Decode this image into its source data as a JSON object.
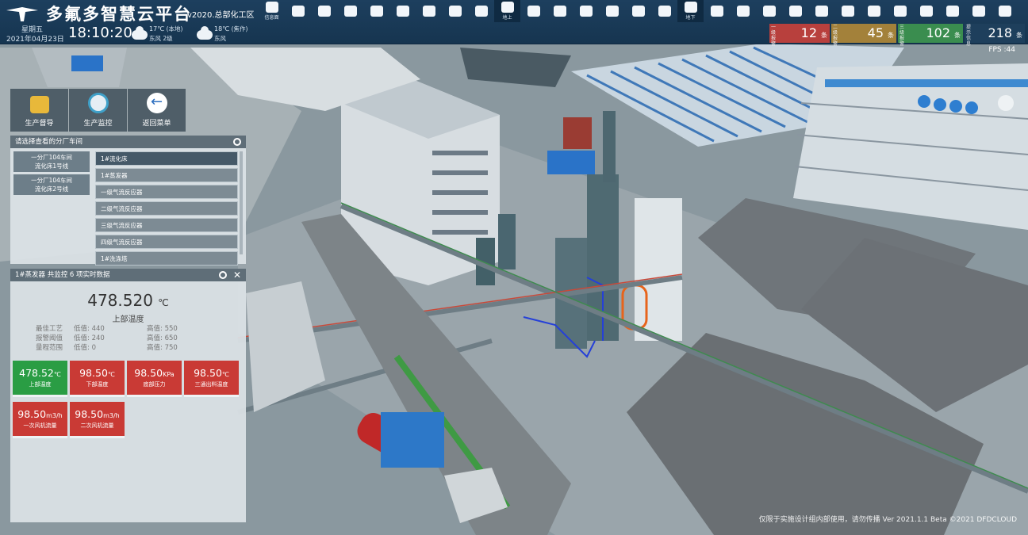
{
  "header": {
    "title": "多氟多智慧云平台",
    "version": "v2020.总部化工区",
    "weekday": "星期五",
    "date": "2021年04月23日",
    "time": "18:10:20",
    "weather": [
      {
        "temp": "17℃",
        "note": "(本地)",
        "wind": "东风 2级"
      },
      {
        "temp": "18℃",
        "note": "(焦作)",
        "wind": "东风"
      }
    ]
  },
  "toolbar": [
    {
      "name": "message-tool",
      "label": "信息面"
    },
    {
      "name": "tool-2",
      "label": ""
    },
    {
      "name": "tool-3",
      "label": ""
    },
    {
      "name": "tool-4",
      "label": ""
    },
    {
      "name": "tool-5",
      "label": ""
    },
    {
      "name": "tool-6",
      "label": ""
    },
    {
      "name": "tool-7",
      "label": ""
    },
    {
      "name": "tool-8",
      "label": ""
    },
    {
      "name": "tool-9",
      "label": ""
    },
    {
      "name": "ground-up-tool",
      "label": "地上"
    },
    {
      "name": "layers-tool",
      "label": ""
    },
    {
      "name": "tool-12",
      "label": ""
    },
    {
      "name": "tool-13",
      "label": ""
    },
    {
      "name": "tool-14",
      "label": ""
    },
    {
      "name": "tool-15",
      "label": ""
    },
    {
      "name": "map-tool",
      "label": ""
    },
    {
      "name": "underground-tool",
      "label": "地下"
    },
    {
      "name": "tool-18",
      "label": ""
    },
    {
      "name": "tool-19",
      "label": ""
    },
    {
      "name": "tool-20",
      "label": ""
    },
    {
      "name": "tool-21",
      "label": ""
    },
    {
      "name": "tool-22",
      "label": ""
    },
    {
      "name": "power-tool",
      "label": ""
    },
    {
      "name": "tool-24",
      "label": ""
    },
    {
      "name": "tool-25",
      "label": ""
    },
    {
      "name": "chat-tool",
      "label": ""
    },
    {
      "name": "tool-27",
      "label": ""
    },
    {
      "name": "settings-tool",
      "label": ""
    },
    {
      "name": "power-off-tool",
      "label": ""
    }
  ],
  "stats": [
    {
      "name": "一级报警",
      "value": "12",
      "unit": "条",
      "color": "#b8403d"
    },
    {
      "name": "二级报警",
      "value": "45",
      "unit": "条",
      "color": "#a3813a"
    },
    {
      "name": "三级报警",
      "value": "102",
      "unit": "条",
      "color": "#3a8d4f"
    },
    {
      "name": "提示信息",
      "value": "218",
      "unit": "条",
      "color": "#1e3f5c"
    }
  ],
  "nav": [
    {
      "label": "生产督导"
    },
    {
      "label": "生产监控"
    },
    {
      "label": "返回菜单"
    }
  ],
  "workshop": {
    "title": "请选择查看的分厂车间",
    "branches": [
      "一分厂104车间\n流化床1号线",
      "一分厂104车间\n流化床2号线"
    ],
    "units": [
      "1#流化床",
      "1#蒸发器",
      "一级气流反应器",
      "二级气流反应器",
      "三级气流反应器",
      "四级气流反应器",
      "1#洗涤塔"
    ]
  },
  "detail": {
    "title": "1#蒸发器 共监控 6 项实时数据",
    "value": "478.520",
    "unit": "℃",
    "label": "上部温度",
    "ranges": [
      {
        "name": "最佳工艺",
        "low": "低值: 440",
        "high": "高值: 550"
      },
      {
        "name": "报警阈值",
        "low": "低值: 240",
        "high": "高值: 650"
      },
      {
        "name": "量程范围",
        "low": "低值: 0",
        "high": "高值: 750"
      }
    ],
    "cards": [
      {
        "value": "478.52",
        "unit": "℃",
        "name": "上部温度",
        "status": "green"
      },
      {
        "value": "98.50",
        "unit": "℃",
        "name": "下部温度",
        "status": "red"
      },
      {
        "value": "98.50",
        "unit": "KPa",
        "name": "底部压力",
        "status": "red"
      },
      {
        "value": "98.50",
        "unit": "℃",
        "name": "三通出料温度",
        "status": "red"
      },
      {
        "value": "98.50",
        "unit": "m3/h",
        "name": "一次风机流量",
        "status": "red"
      },
      {
        "value": "98.50",
        "unit": "m3/h",
        "name": "二次风机流量",
        "status": "red"
      }
    ]
  },
  "fps": "FPS :44",
  "watermark": "仅限于实施设计组内部使用，请勿传播 Ver 2021.1.1 Beta ©2021 DFDCLOUD"
}
